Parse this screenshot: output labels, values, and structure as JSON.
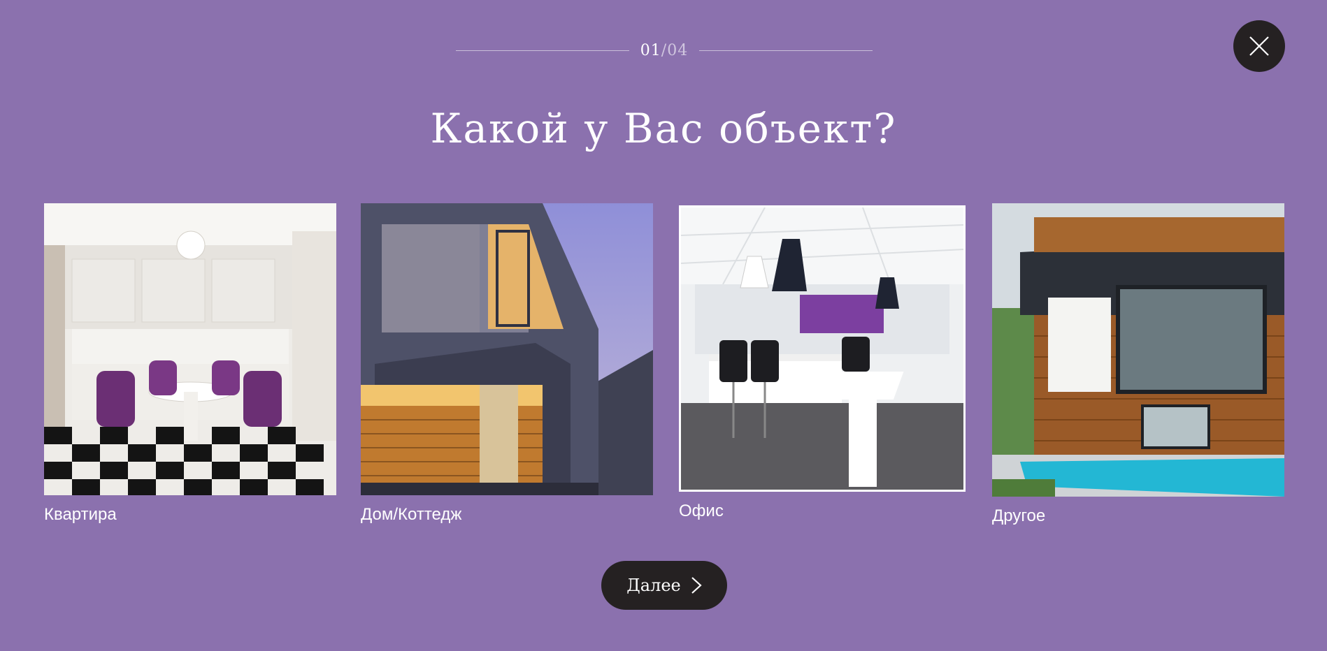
{
  "progress": {
    "current": "01",
    "separator": "/",
    "total": "04"
  },
  "close": {
    "icon": "close-icon"
  },
  "question": {
    "title": "Какой у Вас объект?"
  },
  "options": [
    {
      "label": "Квартира",
      "icon": "apartment-kitchen-photo"
    },
    {
      "label": "Дом/Коттедж",
      "icon": "house-photo"
    },
    {
      "label": "Офис",
      "icon": "office-photo",
      "selected": true
    },
    {
      "label": "Другое",
      "icon": "modern-house-pool-photo"
    }
  ],
  "next": {
    "label": "Далее",
    "icon": "chevron-right-icon"
  },
  "colors": {
    "background": "#8b71ae",
    "dark": "#252122",
    "text": "#ffffff"
  }
}
